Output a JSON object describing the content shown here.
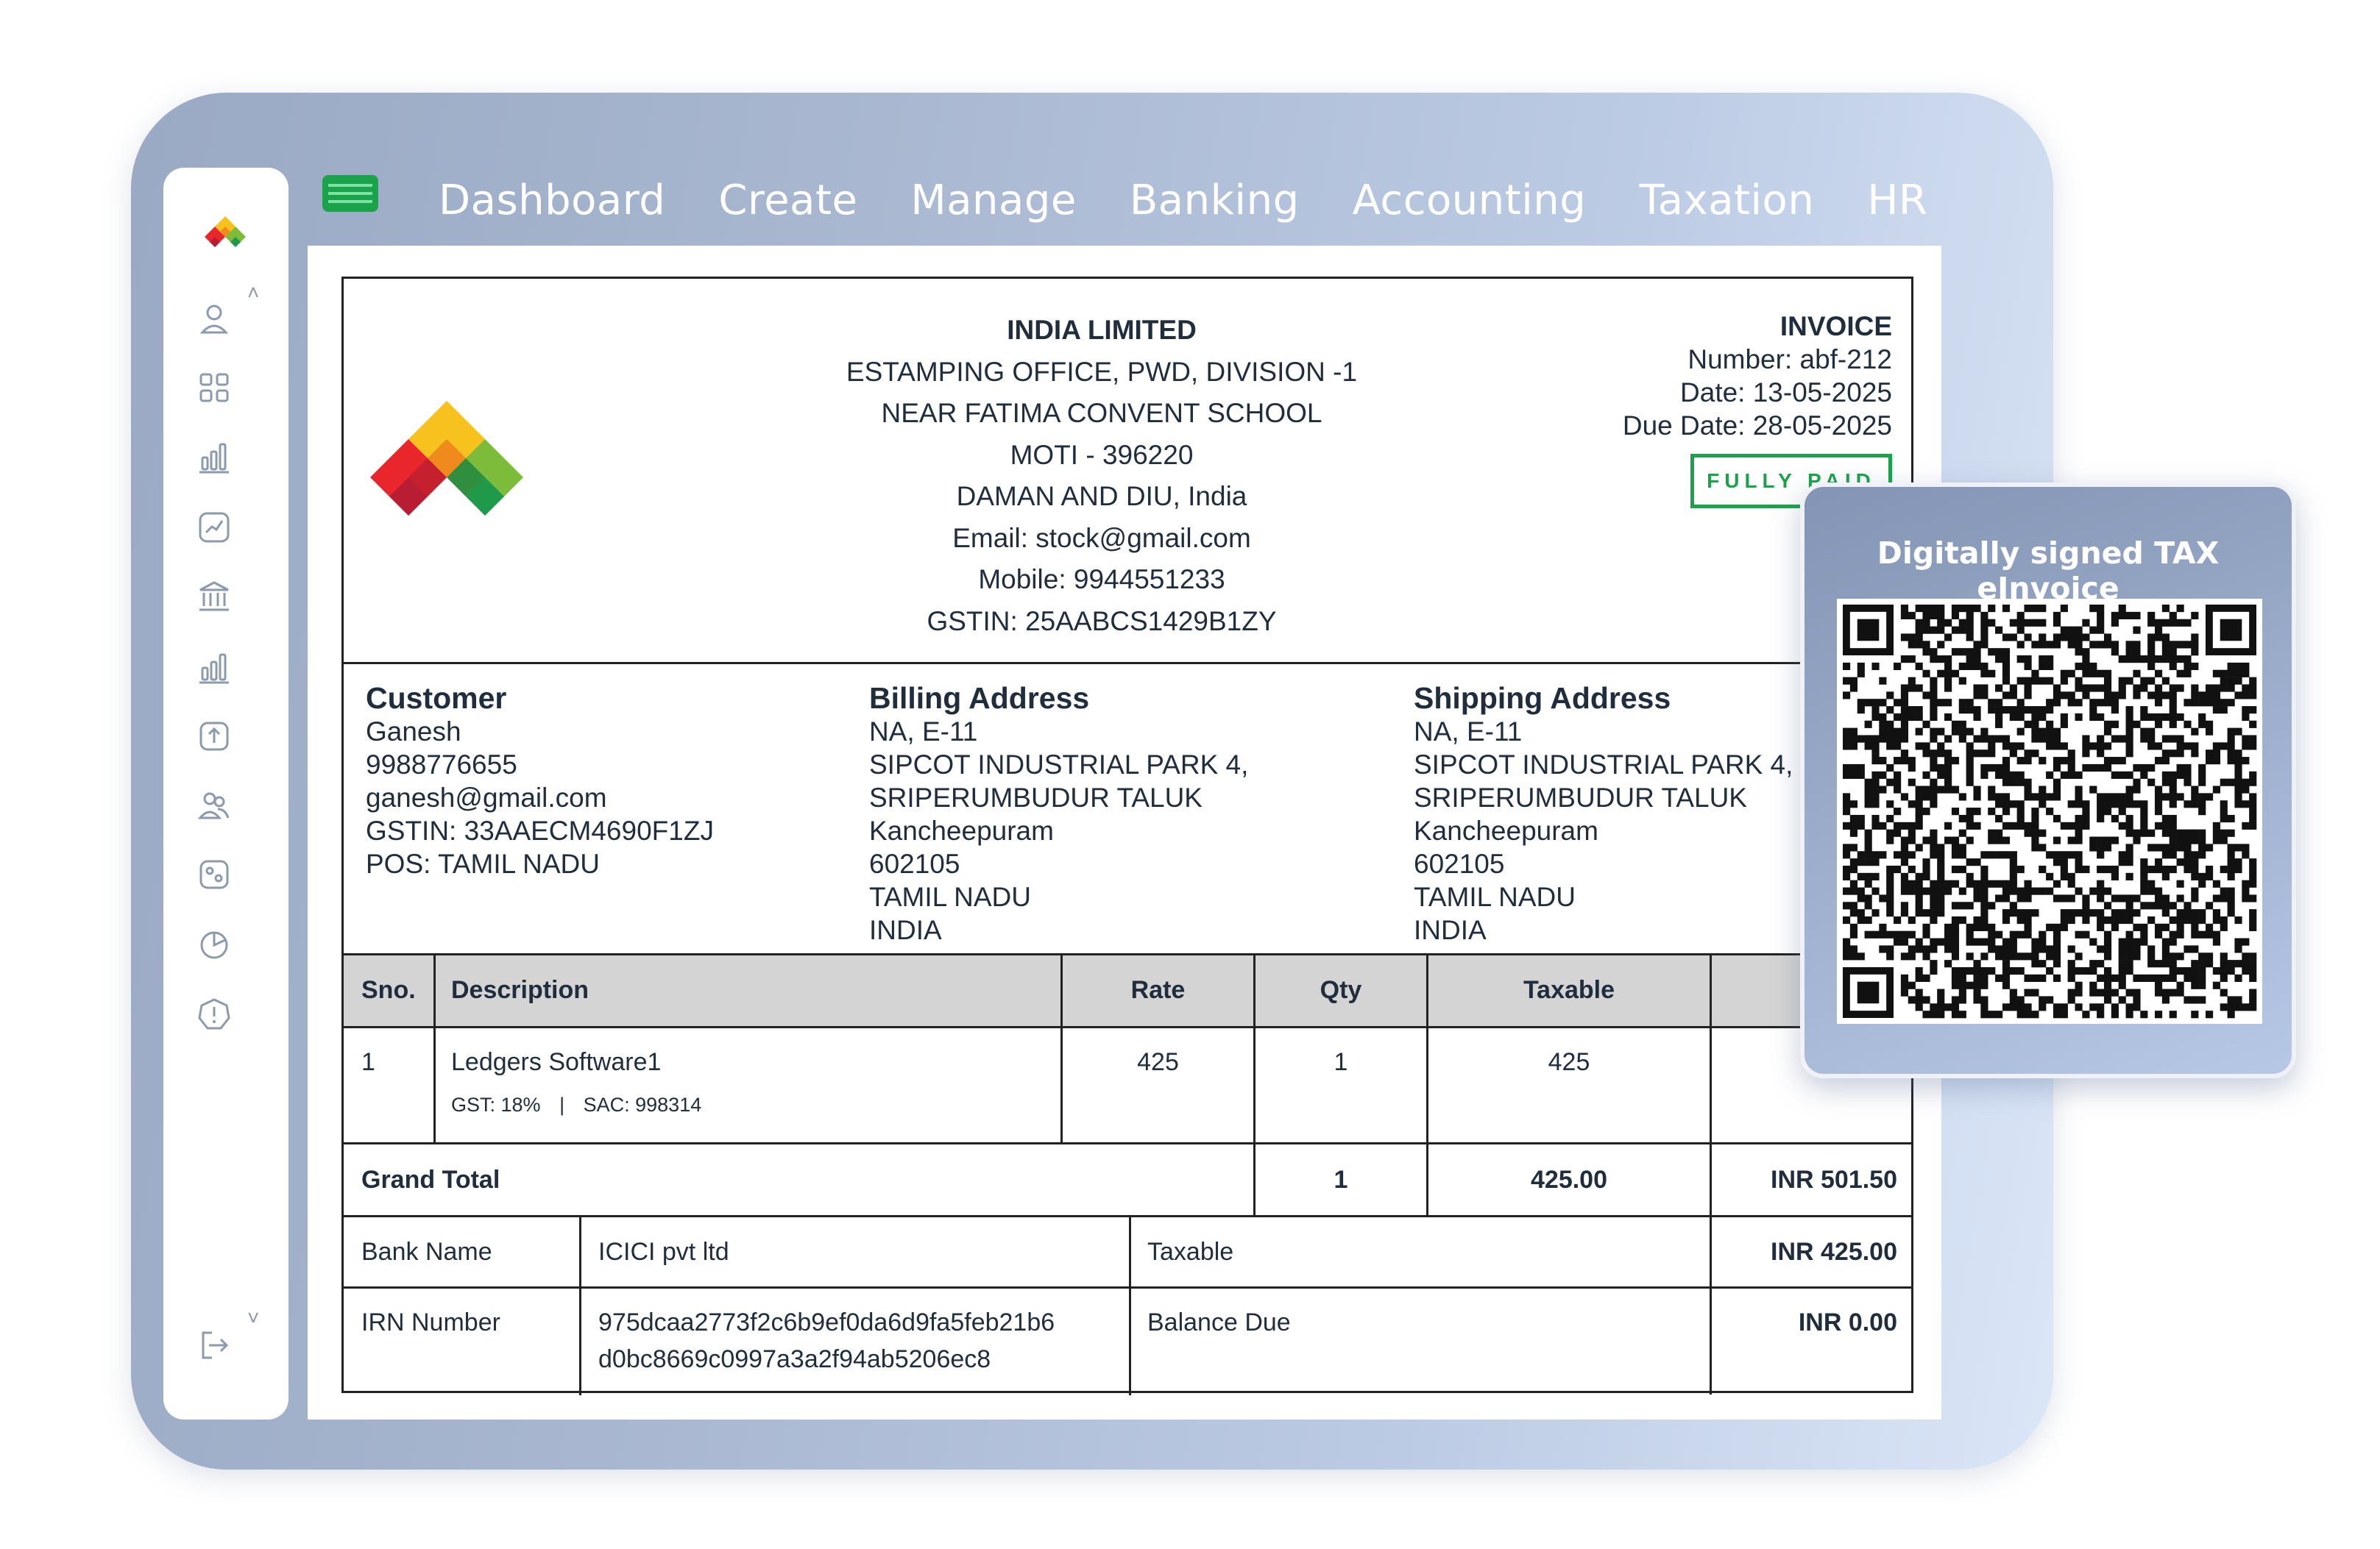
{
  "nav": {
    "items": [
      "Dashboard",
      "Create",
      "Manage",
      "Banking",
      "Accounting",
      "Taxation",
      "HR"
    ]
  },
  "sidebar": {
    "icons": [
      "user-icon",
      "grid-icon",
      "bar-chart-icon",
      "chart-box-icon",
      "bank-icon",
      "bar-chart-2-icon",
      "upload-icon",
      "users-icon",
      "settings-sliders-icon",
      "pie-chart-icon",
      "alert-icon",
      "logout-icon"
    ]
  },
  "company": {
    "name": "INDIA LIMITED",
    "line1": "ESTAMPING OFFICE, PWD, DIVISION -1",
    "line2": "NEAR FATIMA CONVENT SCHOOL",
    "line3": "MOTI - 396220",
    "line4": "DAMAN AND DIU, India",
    "email": "Email: stock@gmail.com",
    "mobile": "Mobile: 9944551233",
    "gstin": "GSTIN: 25AABCS1429B1ZY"
  },
  "invoice": {
    "title": "INVOICE",
    "number": "Number: abf-212",
    "date": "Date: 13-05-2025",
    "due": "Due Date: 28-05-2025",
    "stamp": "FULLY PAID"
  },
  "customer": {
    "heading": "Customer",
    "name": "Ganesh",
    "phone": "9988776655",
    "email": "ganesh@gmail.com",
    "gstin": "GSTIN: 33AAECM4690F1ZJ",
    "pos": "POS: TAMIL NADU"
  },
  "billing": {
    "heading": "Billing Address",
    "l1": "NA, E-11",
    "l2": "SIPCOT INDUSTRIAL PARK 4,",
    "l3": "SRIPERUMBUDUR TALUK",
    "l4": "Kancheepuram",
    "l5": "602105",
    "l6": "TAMIL NADU",
    "l7": "INDIA"
  },
  "shipping": {
    "heading": "Shipping Address",
    "l1": "NA, E-11",
    "l2": "SIPCOT INDUSTRIAL PARK 4,",
    "l3": "SRIPERUMBUDUR TALUK",
    "l4": "Kancheepuram",
    "l5": "602105",
    "l6": "TAMIL NADU",
    "l7": "INDIA"
  },
  "table": {
    "headers": {
      "sno": "Sno.",
      "desc": "Description",
      "rate": "Rate",
      "qty": "Qty",
      "taxable": "Taxable"
    },
    "row": {
      "sno": "1",
      "desc": "Ledgers Software1",
      "gst": "GST: 18%",
      "sac": "SAC: 998314",
      "rate": "425",
      "qty": "1",
      "taxable": "425"
    },
    "grand": {
      "label": "Grand Total",
      "qty": "1",
      "taxable": "425.00",
      "total": "INR 501.50"
    },
    "bank": {
      "label": "Bank Name",
      "value": "ICICI pvt ltd",
      "right_label": "Taxable",
      "right_value": "INR 425.00"
    },
    "irn": {
      "label": "IRN Number",
      "value1": "975dcaa2773f2c6b9ef0da6d9fa5feb21b6",
      "value2": "d0bc8669c0997a3a2f94ab5206ec8",
      "right_label": "Balance Due",
      "right_value": "INR 0.00"
    }
  },
  "qr": {
    "title": "Digitally signed TAX eInvoice"
  },
  "colors": {
    "green": "#1aa34a",
    "logo_red": "#e8262c",
    "logo_yellow": "#f7c21e",
    "logo_orange": "#f08a1c",
    "logo_green": "#7dbb3a",
    "logo_dark_green": "#1f9a4a"
  }
}
